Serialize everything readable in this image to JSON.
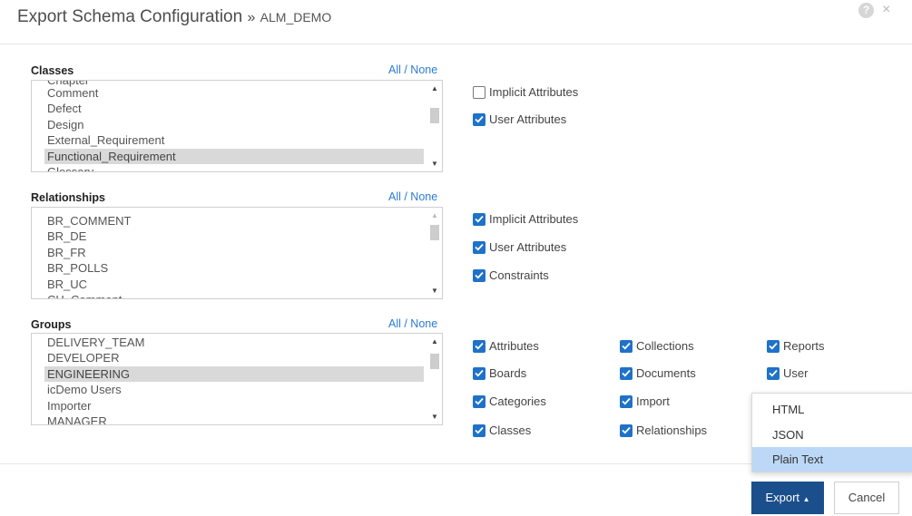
{
  "header": {
    "title": "Export Schema Configuration",
    "separator": "»",
    "subtitle": "ALM_DEMO",
    "help_icon_glyph": "?",
    "close_icon_glyph": "×"
  },
  "sections": {
    "classes": {
      "label": "Classes",
      "all_none": "All / None",
      "partial_top": "Chapter",
      "items": [
        "Comment",
        "Defect",
        "Design",
        "External_Requirement",
        "Functional_Requirement"
      ],
      "selected": "Functional_Requirement",
      "partial_bottom": "Glossary",
      "options": [
        {
          "label": "Implicit Attributes",
          "checked": false
        },
        {
          "label": "User Attributes",
          "checked": true
        }
      ]
    },
    "relationships": {
      "label": "Relationships",
      "all_none": "All / None",
      "items": [
        "BR_COMMENT",
        "BR_DE",
        "BR_FR",
        "BR_POLLS",
        "BR_UC"
      ],
      "partial_bottom": "CH_Comment",
      "options": [
        {
          "label": "Implicit Attributes",
          "checked": true
        },
        {
          "label": "User Attributes",
          "checked": true
        },
        {
          "label": "Constraints",
          "checked": true
        }
      ]
    },
    "groups": {
      "label": "Groups",
      "all_none": "All / None",
      "items": [
        "DELIVERY_TEAM",
        "DEVELOPER",
        "ENGINEERING",
        "icDemo Users",
        "Importer",
        "MANAGER"
      ],
      "selected": "ENGINEERING",
      "options": [
        {
          "label": "Attributes",
          "checked": true
        },
        {
          "label": "Collections",
          "checked": true
        },
        {
          "label": "Reports",
          "checked": true
        },
        {
          "label": "Boards",
          "checked": true
        },
        {
          "label": "Documents",
          "checked": true
        },
        {
          "label": "User",
          "checked": true
        },
        {
          "label": "Categories",
          "checked": true
        },
        {
          "label": "Import",
          "checked": true
        },
        {
          "label": "Classes",
          "checked": true
        },
        {
          "label": "Relationships",
          "checked": true
        }
      ]
    }
  },
  "export_menu": {
    "options": [
      "HTML",
      "JSON",
      "Plain Text"
    ],
    "highlighted": "Plain Text"
  },
  "footer": {
    "export_label": "Export",
    "export_caret": "▲",
    "cancel_label": "Cancel"
  },
  "colors": {
    "accent": "#1f72c8",
    "link": "#2c7bd6",
    "primary_button": "#1b4f8c",
    "menu_highlight": "#bcd8f6",
    "list_selection": "#d9d9d9"
  }
}
